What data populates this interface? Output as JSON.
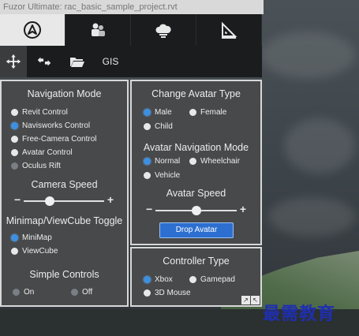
{
  "window": {
    "title": "Fuzor Ultimate: rac_basic_sample_project.rvt"
  },
  "tabs": [
    {
      "icon": "navigation-compass-icon"
    },
    {
      "icon": "avatar-group-icon"
    },
    {
      "icon": "cloud-icon"
    },
    {
      "icon": "ruler-measure-icon"
    }
  ],
  "toolbar": {
    "move_icon": "move-arrows-icon",
    "back_icon": "undo-arrows-icon",
    "folder_icon": "folder-icon",
    "gis_label": "GIS"
  },
  "navigation": {
    "title": "Navigation Mode",
    "options": [
      {
        "label": "Revit Control",
        "state": "off"
      },
      {
        "label": "Navisworks Control",
        "state": "on"
      },
      {
        "label": "Free-Camera Control",
        "state": "off"
      },
      {
        "label": "Avatar Control",
        "state": "off"
      },
      {
        "label": "Oculus Rift",
        "state": "dim"
      }
    ],
    "camera_speed": {
      "title": "Camera Speed",
      "minus": "−",
      "plus": "+",
      "level": 0.3
    },
    "minimap_title": "Minimap/ViewCube Toggle",
    "minimap_options": [
      {
        "label": "MiniMap",
        "state": "on"
      },
      {
        "label": "ViewCube",
        "state": "off"
      }
    ],
    "simple_title": "Simple Controls",
    "simple_options": [
      {
        "label": "On",
        "state": "dim"
      },
      {
        "label": "Off",
        "state": "dim"
      }
    ]
  },
  "avatar": {
    "type_title": "Change Avatar Type",
    "type_options": [
      {
        "label": "Male",
        "state": "on"
      },
      {
        "label": "Female",
        "state": "off"
      },
      {
        "label": "Child",
        "state": "off"
      }
    ],
    "nav_title": "Avatar Navigation Mode",
    "nav_options": [
      {
        "label": "Normal",
        "state": "on"
      },
      {
        "label": "Wheelchair",
        "state": "off"
      },
      {
        "label": "Vehicle",
        "state": "off"
      }
    ],
    "speed": {
      "title": "Avatar Speed",
      "minus": "−",
      "plus": "+",
      "level": 0.5
    },
    "drop_button": "Drop Avatar"
  },
  "controller": {
    "title": "Controller Type",
    "options": [
      {
        "label": "Xbox",
        "state": "on"
      },
      {
        "label": "Gamepad",
        "state": "off"
      },
      {
        "label": "3D Mouse",
        "state": "off"
      }
    ]
  },
  "watermark": "最需教育",
  "colors": {
    "accent": "#3d8fe0",
    "panel": "#48494a",
    "button": "#2d6fd1"
  }
}
